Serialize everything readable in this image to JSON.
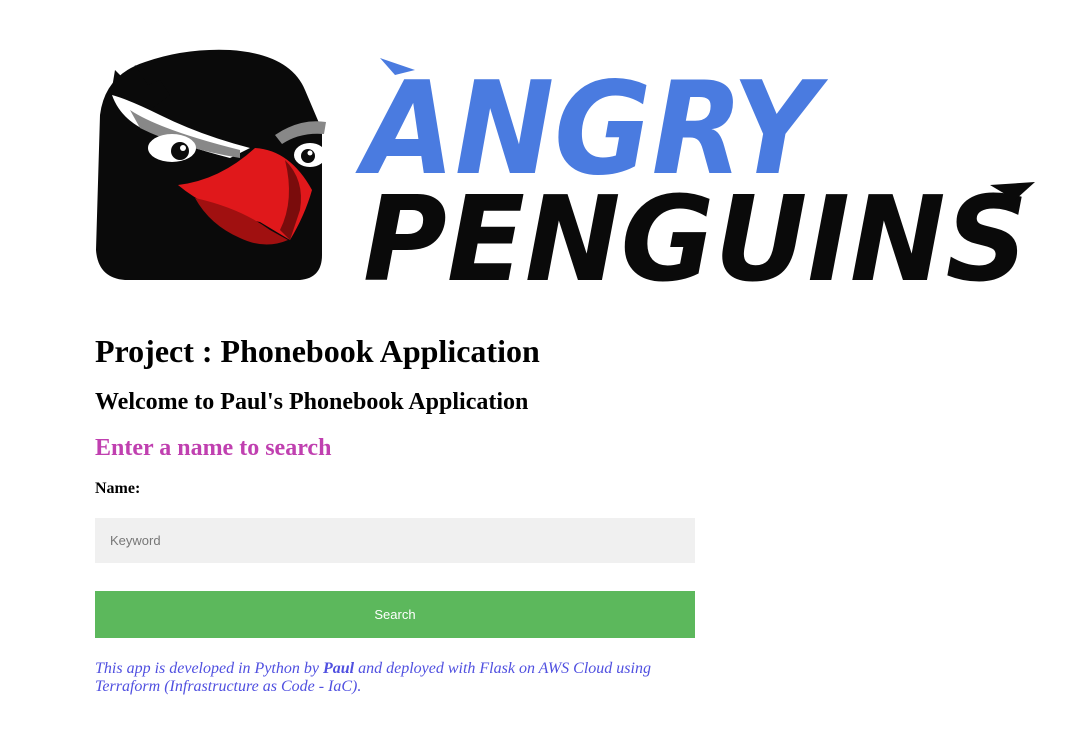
{
  "logo": {
    "line1": "ANGRY",
    "line2": "PENGUINS"
  },
  "header": {
    "project_title": "Project : Phonebook Application",
    "welcome": "Welcome to Paul's Phonebook Application"
  },
  "search": {
    "heading": "Enter a name to search",
    "name_label": "Name:",
    "placeholder": "Keyword",
    "button_label": "Search"
  },
  "footer": {
    "text_before": "This app is developed in Python by ",
    "author": "Paul",
    "text_after": " and deployed with Flask on AWS Cloud using Terraform (Infrastructure as Code - IaC)."
  },
  "colors": {
    "search_heading": "#c040b0",
    "button": "#5cb85c",
    "footer_text": "#5050e0",
    "logo_blue": "#4a7be0"
  }
}
